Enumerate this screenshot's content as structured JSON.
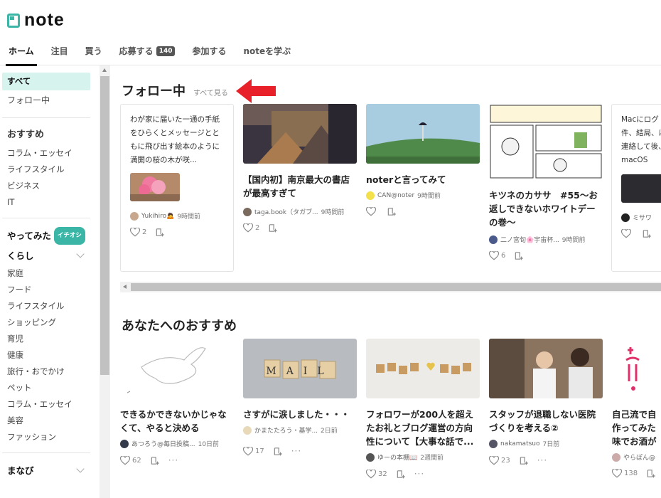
{
  "header": {
    "logo_text": "note"
  },
  "topnav": [
    {
      "label": "ホーム",
      "active": true
    },
    {
      "label": "注目"
    },
    {
      "label": "買う"
    },
    {
      "label": "応募する",
      "badge": "140"
    },
    {
      "label": "参加する"
    },
    {
      "label": "noteを学ぶ"
    }
  ],
  "sidebar": {
    "all": "すべて",
    "following": "フォロー中",
    "recommended_head": "おすすめ",
    "recommended": [
      "コラム・エッセイ",
      "ライフスタイル",
      "ビジネス",
      "IT"
    ],
    "tried_head": "やってみた",
    "tried_badge": "イチオシ",
    "life_head": "くらし",
    "life": [
      "家庭",
      "フード",
      "ライフスタイル",
      "ショッピング",
      "育児",
      "健康",
      "旅行・おでかけ",
      "ペット",
      "コラム・エッセイ",
      "美容",
      "ファッション"
    ],
    "learn_head": "まなび"
  },
  "following": {
    "title": "フォロー中",
    "see_all": "すべて見る",
    "text_card": {
      "body": "わが家に届いた一通の手紙をひらくとメッセージとともに飛び出す絵本のように満開の桜の木が咲...",
      "author": "Yukihiro🙇",
      "time": "9時間前",
      "likes": "2"
    },
    "cards": [
      {
        "title": "【国内初】南京最大の書店が最高すぎて",
        "author": "taga.book（タガブ...",
        "time": "9時間前",
        "likes": "2"
      },
      {
        "title": "noterと言ってみて",
        "author": "CAN@noter",
        "time": "9時間前",
        "likes": ""
      },
      {
        "title": "キツネのカササ　#55～お返しできないホワイトデーの巻～",
        "author": "二ノ宮旬🌸宇宙杯...",
        "time": "9時間前",
        "likes": "6"
      }
    ],
    "partial": {
      "body": "Macにログ件、結局、に連絡して後、macOS",
      "author": "ミサワ",
      "likes": ""
    }
  },
  "recommend": {
    "title": "あなたへのおすすめ",
    "cards": [
      {
        "title": "できるかできないかじゃなくて、やると決める",
        "author": "あつろう@毎日投稿...",
        "time": "10日前",
        "likes": "62"
      },
      {
        "title": "さすがに涙しました・・・",
        "author": "かまたたろう・基学...",
        "time": "2日前",
        "likes": "17"
      },
      {
        "title": "フォロワーが200人を超えたお礼とブログ運営の方向性について【大事な話で...",
        "author": "ゆーの本棚📖",
        "time": "2週間前",
        "likes": "32"
      },
      {
        "title": "スタッフが退職しない医院づくりを考える②",
        "author": "nakamatsuo",
        "time": "7日前",
        "likes": "23"
      },
      {
        "title": "自己流で自作ってみた味でお酒が",
        "author": "やらぽん@",
        "time": "",
        "likes": "138"
      }
    ],
    "mail_tiles": "MAIL"
  },
  "colors": {
    "accent": "#3bb5a6",
    "arrow": "#e8202a"
  }
}
